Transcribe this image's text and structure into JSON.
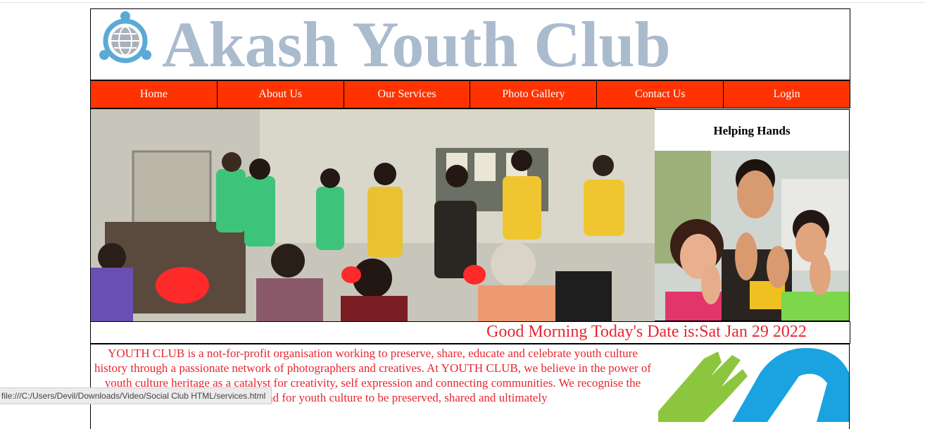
{
  "header": {
    "title": "Akash Youth Club",
    "logo_icon": "globe-people-icon"
  },
  "nav": {
    "items": [
      {
        "label": "Home"
      },
      {
        "label": "About Us"
      },
      {
        "label": "Our Services"
      },
      {
        "label": "Photo Gallery"
      },
      {
        "label": "Contact Us"
      },
      {
        "label": "Login"
      }
    ]
  },
  "sidebar": {
    "heading": "Helping Hands"
  },
  "greeting": {
    "text": "Good Morning Today's Date is:Sat Jan 29 2022"
  },
  "content": {
    "about": "YOUTH CLUB is a not-for-profit organisation working to preserve, share, educate and celebrate youth culture history through a passionate network of photographers and creatives. At YOUTH CLUB, we believe in the power of youth culture heritage as a catalyst for creativity, self expression and connecting communities. We recognise the growing demand for youth culture to be preserved, shared and ultimately"
  },
  "status_bar": {
    "url": "file:///C:/Users/Devil/Downloads/Video/Social Club HTML/services.html"
  },
  "colors": {
    "nav_bg": "#ff3300",
    "title": "#aabbce",
    "accent_text": "#e8262e"
  }
}
